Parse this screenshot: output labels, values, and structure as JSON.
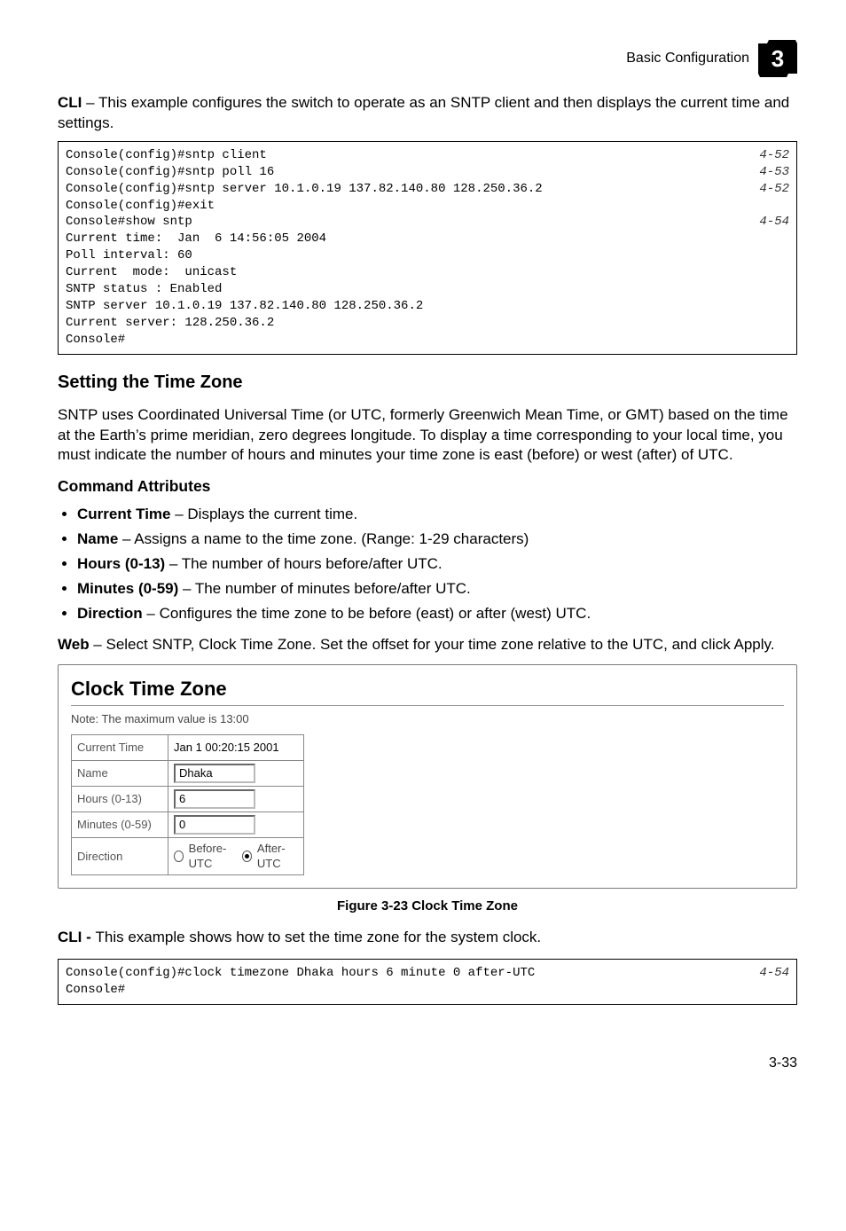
{
  "header": {
    "section": "Basic Configuration",
    "chapter_glyph": "3"
  },
  "intro1": {
    "label": "CLI",
    "text": " – This example configures the switch to operate as an SNTP client and then displays the current time and settings."
  },
  "code1": {
    "lines": [
      {
        "t": "Console(config)#sntp client",
        "r": "4-52"
      },
      {
        "t": "Console(config)#sntp poll 16",
        "r": "4-53"
      },
      {
        "t": "Console(config)#sntp server 10.1.0.19 137.82.140.80 128.250.36.2",
        "r": "4-52"
      },
      {
        "t": "Console(config)#exit",
        "r": ""
      },
      {
        "t": "Console#show sntp",
        "r": "4-54"
      },
      {
        "t": "Current time:  Jan  6 14:56:05 2004",
        "r": ""
      },
      {
        "t": "Poll interval: 60",
        "r": ""
      },
      {
        "t": "Current  mode:  unicast",
        "r": ""
      },
      {
        "t": "SNTP status : Enabled",
        "r": ""
      },
      {
        "t": "SNTP server 10.1.0.19 137.82.140.80 128.250.36.2",
        "r": ""
      },
      {
        "t": "Current server: 128.250.36.2",
        "r": ""
      },
      {
        "t": "Console#",
        "r": ""
      }
    ]
  },
  "section2": {
    "heading": "Setting the Time Zone",
    "para": "SNTP uses Coordinated Universal Time (or UTC, formerly Greenwich Mean Time, or GMT) based on the time at the Earth’s prime meridian, zero degrees longitude. To display a time corresponding to your local time, you must indicate the number of hours and minutes your time zone is east (before) or west (after) of UTC.",
    "cmdattr": "Command Attributes",
    "bullets": [
      {
        "b": "Current Time",
        "t": " – Displays the current time."
      },
      {
        "b": "Name",
        "t": " – Assigns a name to the time zone. (Range: 1-29 characters)"
      },
      {
        "b": "Hours (0-13)",
        "t": " – The number of hours before/after UTC."
      },
      {
        "b": "Minutes (0-59)",
        "t": " – The number of minutes before/after UTC."
      },
      {
        "b": "Direction",
        "t": " – Configures the time zone to be before (east) or after (west) UTC."
      }
    ],
    "weblabel": "Web",
    "webtext": " – Select SNTP, Clock Time Zone. Set the offset for your time zone relative to the UTC, and click Apply."
  },
  "panel": {
    "title": "Clock Time Zone",
    "note": "Note: The maximum value is 13:00",
    "rows": {
      "current_time": {
        "label": "Current Time",
        "value": "Jan 1 00:20:15 2001"
      },
      "name": {
        "label": "Name",
        "value": "Dhaka"
      },
      "hours": {
        "label": "Hours (0-13)",
        "value": "6"
      },
      "minutes": {
        "label": "Minutes (0-59)",
        "value": "0"
      },
      "direction": {
        "label": "Direction",
        "opt1": "Before-UTC",
        "opt2": "After-UTC",
        "selected": "after"
      }
    }
  },
  "figure": {
    "caption": "Figure 3-23   Clock Time Zone"
  },
  "cli2": {
    "label": "CLI - ",
    "text": "This example shows how to set the time zone for the system clock."
  },
  "code2": {
    "lines": [
      {
        "t": "Console(config)#clock timezone Dhaka hours 6 minute 0 after-UTC",
        "r": "4-54"
      },
      {
        "t": "Console#",
        "r": ""
      }
    ]
  },
  "footer": {
    "page": "3-33"
  }
}
